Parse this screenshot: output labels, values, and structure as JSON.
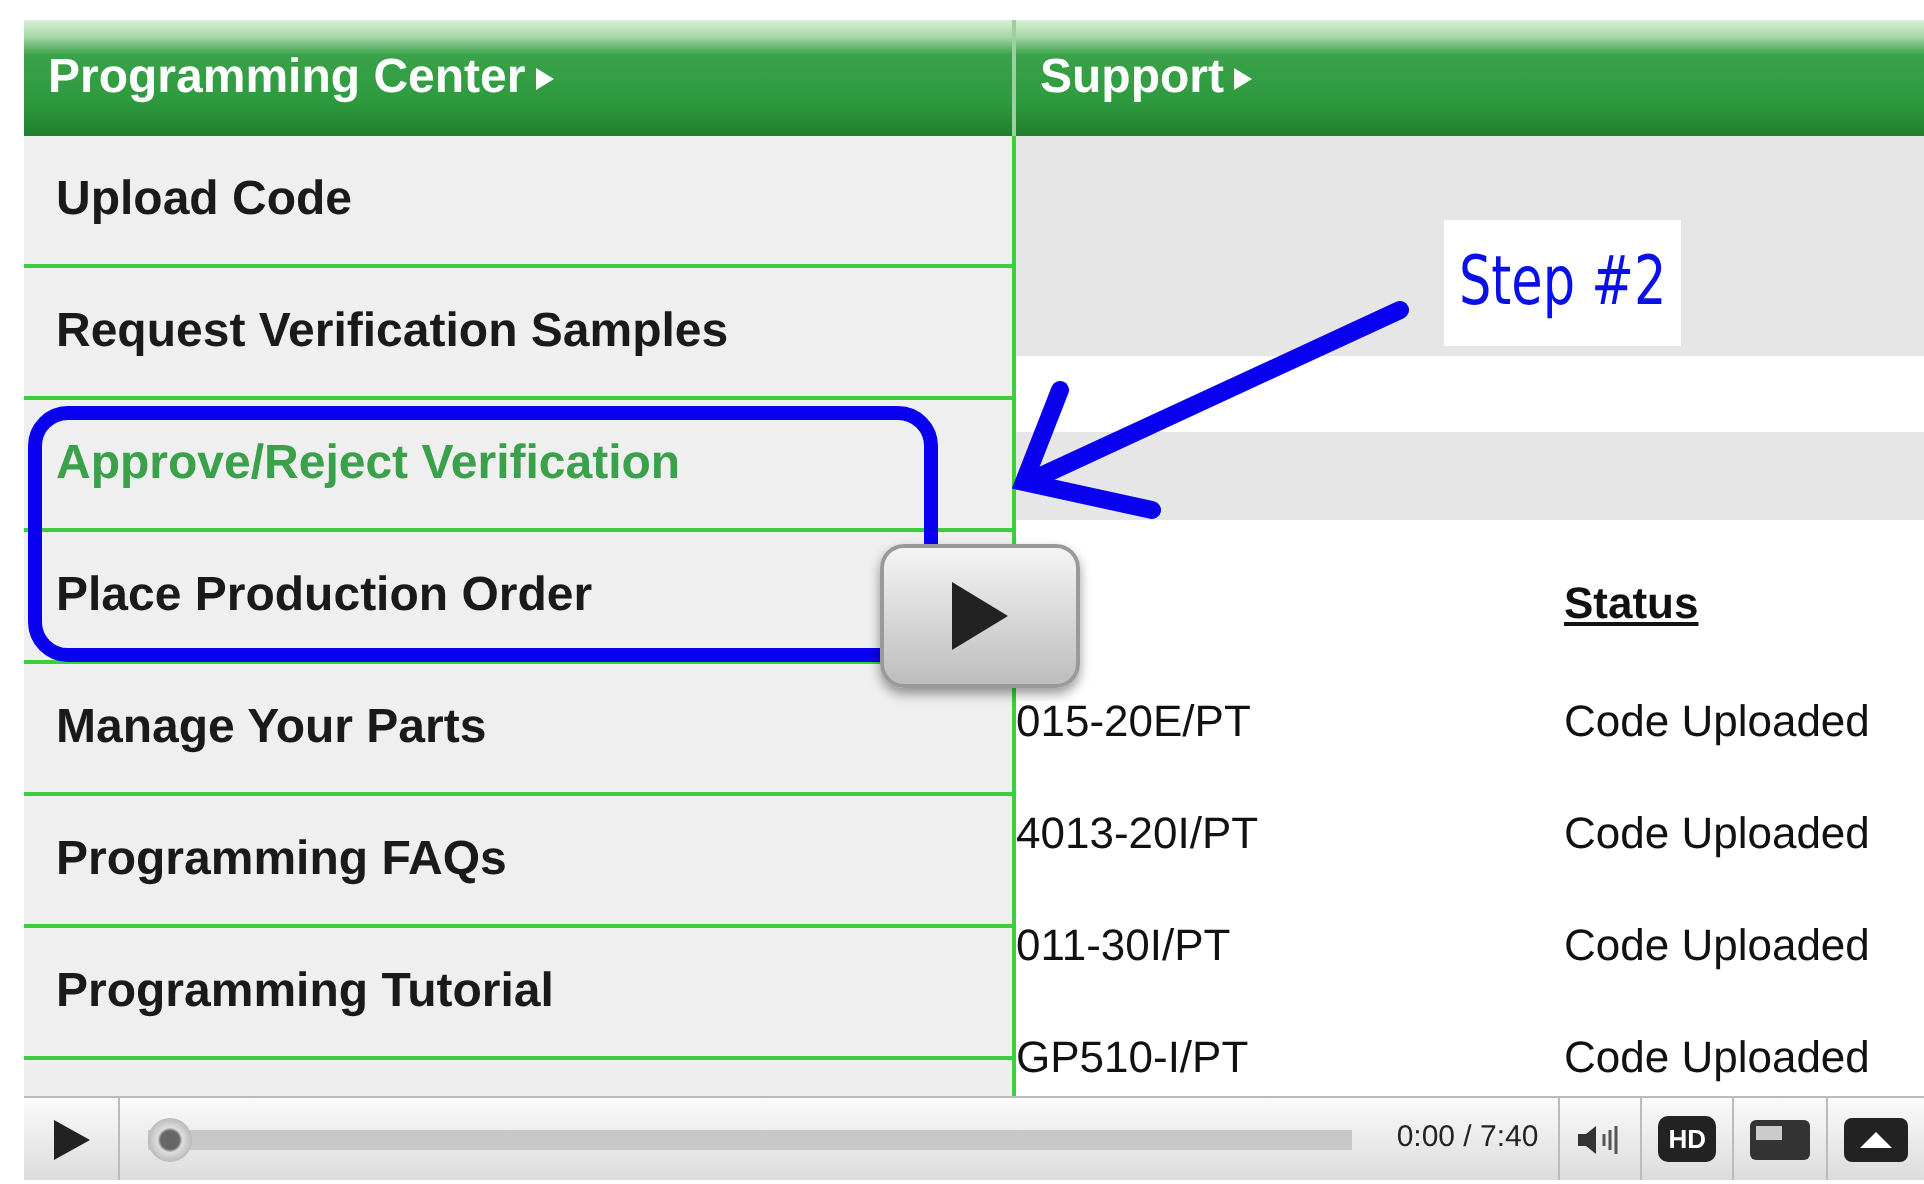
{
  "header_tabs": [
    {
      "label": "Programming Center"
    },
    {
      "label": "Support"
    }
  ],
  "menu_items": [
    {
      "label": "Upload Code",
      "selected": false
    },
    {
      "label": "Request Verification Samples",
      "selected": false
    },
    {
      "label": "Approve/Reject Verification",
      "selected": true
    },
    {
      "label": "Place Production Order",
      "selected": false
    },
    {
      "label": "Manage Your Parts",
      "selected": false
    },
    {
      "label": "Programming FAQs",
      "selected": false
    },
    {
      "label": "Programming Tutorial",
      "selected": false
    }
  ],
  "table": {
    "columns": [
      "Status"
    ],
    "rows": [
      {
        "column_1": "015-20E/PT",
        "status": "Code Uploaded"
      },
      {
        "column_1": "4013-20I/PT",
        "status": "Code Uploaded"
      },
      {
        "column_1": "011-30I/PT",
        "status": "Code Uploaded"
      },
      {
        "column_1": "GP510-I/PT",
        "status": "Code Uploaded"
      }
    ]
  },
  "annotation": {
    "label": "Step #2"
  },
  "player": {
    "time": "0:00 / 7:40",
    "level": 0,
    "hd_label": "HD"
  }
}
